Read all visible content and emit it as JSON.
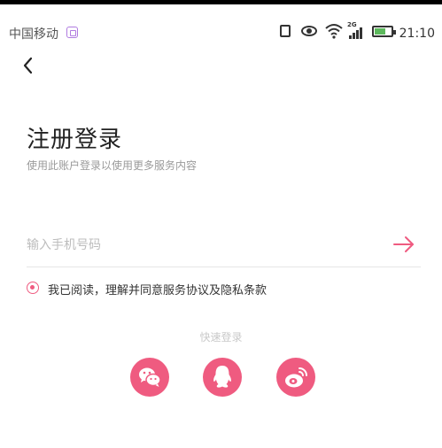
{
  "status_bar": {
    "carrier": "中国移动",
    "network": "2G",
    "time": "21:10",
    "icons": [
      "vibrate-icon",
      "eye-icon",
      "wifi-icon",
      "signal-icon",
      "battery-icon"
    ]
  },
  "header": {
    "back_icon": "chevron-left-icon"
  },
  "page": {
    "title": "注册登录",
    "subtitle": "使用此账户登录以使用更多服务内容"
  },
  "phone": {
    "placeholder": "输入手机号码",
    "value": "",
    "submit_icon": "arrow-right-icon"
  },
  "agreement": {
    "text": "我已阅读，理解并同意服务协议及隐私条款",
    "checked": true
  },
  "quick_login": {
    "label": "快速登录",
    "options": [
      "wechat-icon",
      "qq-icon",
      "weibo-icon"
    ]
  },
  "colors": {
    "accent": "#ef5b80",
    "title": "#222222",
    "subtitle": "#9a9a9a",
    "placeholder": "#bdbdbd",
    "divider": "#e6e6e6"
  }
}
